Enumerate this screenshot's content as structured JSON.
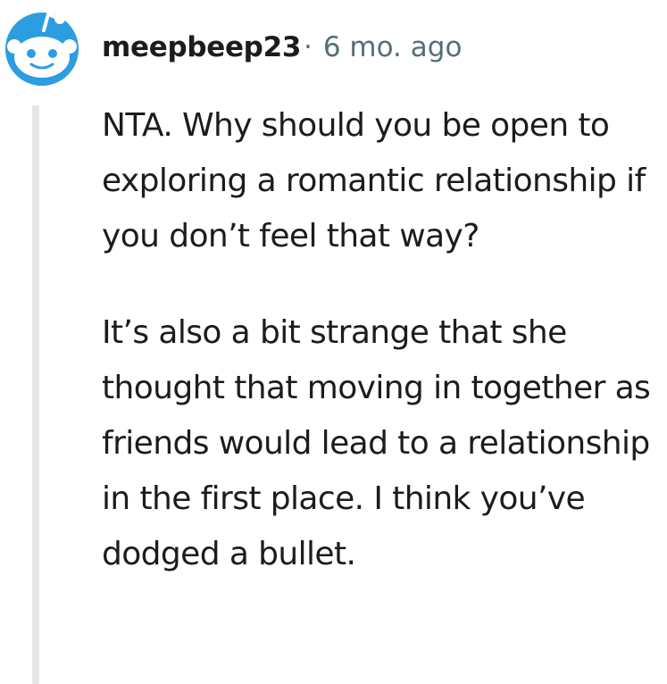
{
  "comment": {
    "avatar_icon": "snoo-avatar-icon",
    "username": "meepbeep23",
    "separator": "·",
    "timestamp": "6 mo. ago",
    "paragraphs": [
      "NTA. Why should you be open to exploring a romantic relationship if you don’t feel that way?",
      "It’s also a bit strange that she thought that moving in together as friends would lead to a relationship in the first place. I think you’ve dodged a bullet."
    ]
  },
  "colors": {
    "avatar_bg": "#2c9de0",
    "text": "#1c1c1c",
    "meta_text": "#576f76",
    "thread_line": "#e6e6e6"
  }
}
